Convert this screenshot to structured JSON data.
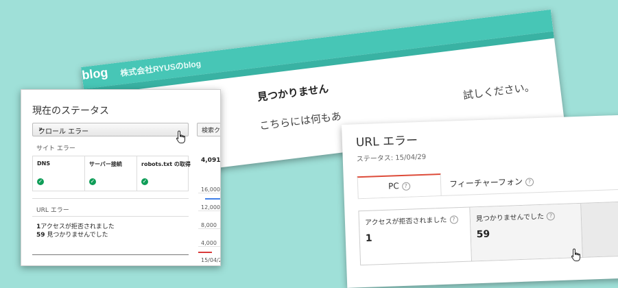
{
  "blog": {
    "logo": "blog",
    "site_name": "株式会社RYUSのblog",
    "heading": "見つかりません",
    "body_text": "こちらには何もあ",
    "body_text_end": "試しください。"
  },
  "status_panel": {
    "title": "現在のステータス",
    "crawl_button": "クロール エラー",
    "site_errors_label": "サイト エラー",
    "site_errors": [
      {
        "label": "DNS"
      },
      {
        "label": "サーバー接続"
      },
      {
        "label": "robots.txt の取得"
      }
    ],
    "url_errors_label": "URL エラー",
    "url_errors": [
      {
        "count": "1",
        "text": "アクセスが拒否されました"
      },
      {
        "count": "59",
        "text": "見つかりませんでした"
      }
    ],
    "side_tab": "検索ク",
    "side_value": "4,091",
    "side_axis": [
      "16,000",
      "12,000",
      "8,000",
      "4,000"
    ],
    "side_date": "15/04/2"
  },
  "url_error_panel": {
    "title": "URL エラー",
    "status_line": "ステータス: 15/04/29",
    "tabs": [
      {
        "label": "PC",
        "active": true
      },
      {
        "label": "フィーチャーフォン",
        "active": false
      }
    ],
    "metrics": [
      {
        "label": "アクセスが拒否されました",
        "value": "1"
      },
      {
        "label": "見つかりませんでした",
        "value": "59"
      }
    ]
  }
}
